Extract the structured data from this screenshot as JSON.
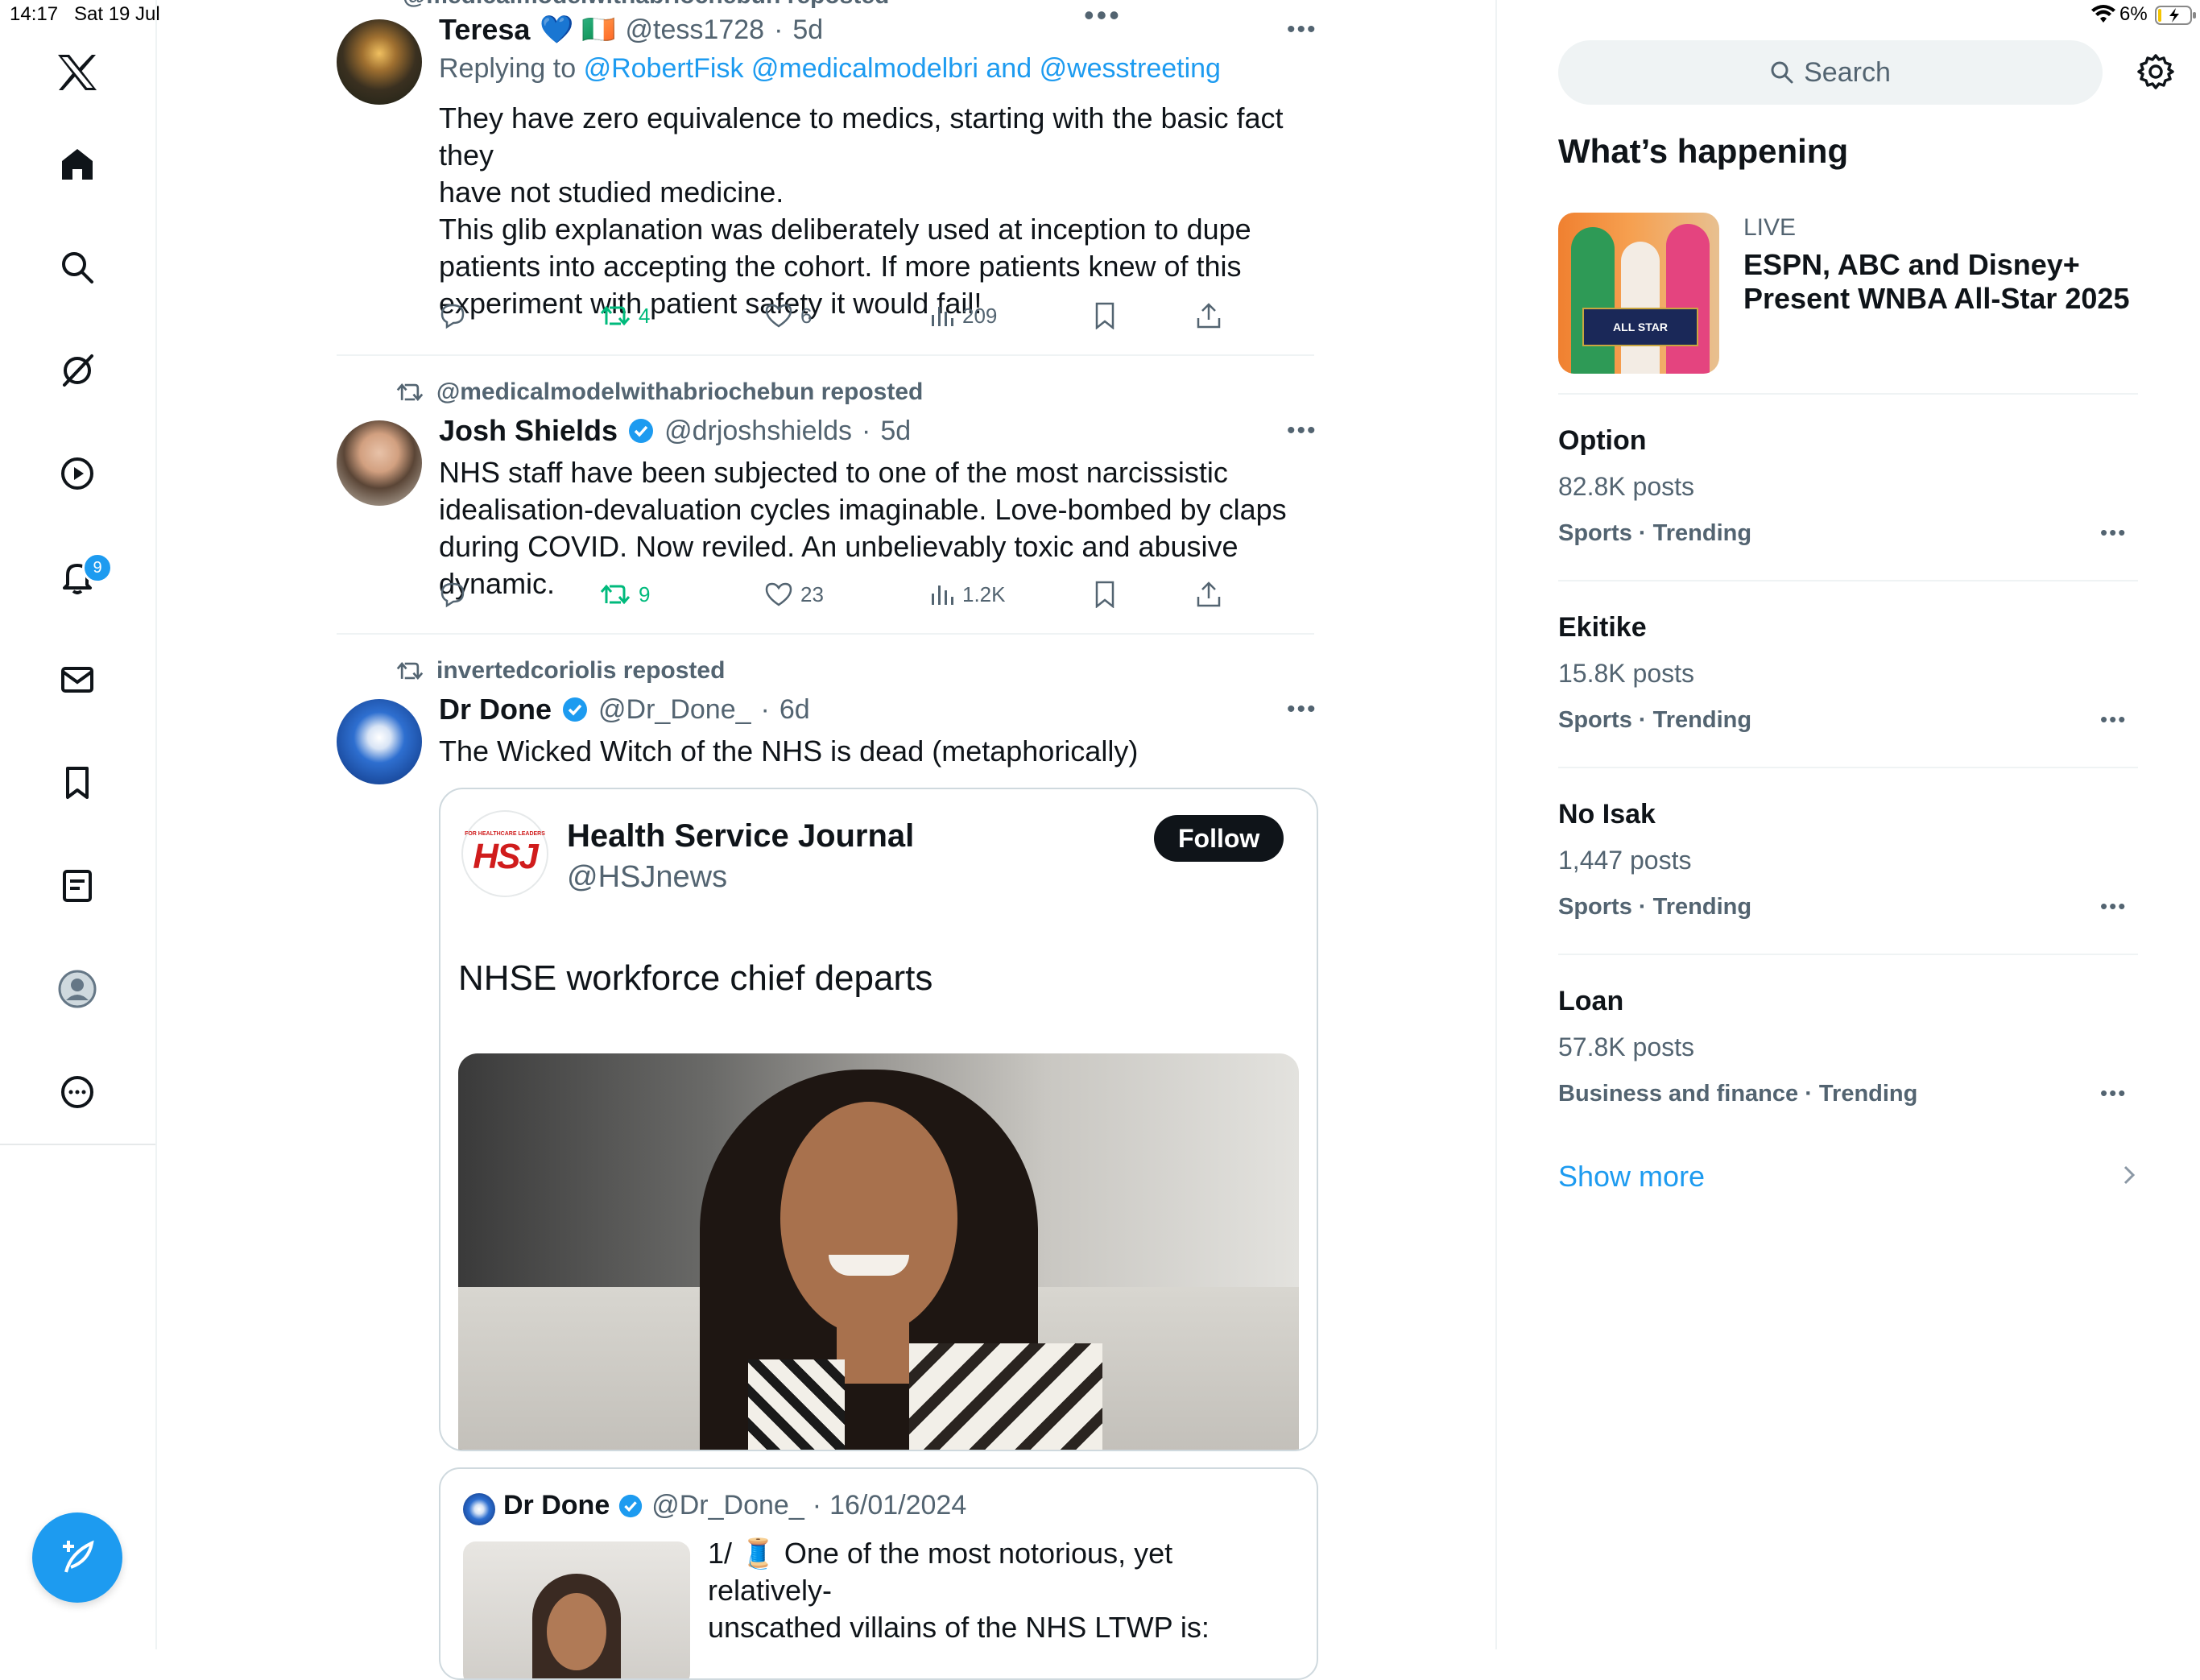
{
  "status_bar": {
    "time": "14:17",
    "date": "Sat 19 Jul",
    "battery": "6%"
  },
  "nav": {
    "notification_count": "9"
  },
  "feed": {
    "top_cut_text": "@medicalmodelwithabriochebun reposted",
    "tweets": [
      {
        "name": "Teresa",
        "name_emojis": "💙 🇮🇪",
        "handle": "@tess1728",
        "time": "5d",
        "replying_prefix": "Replying to",
        "replying_targets": "@RobertFisk @medicalmodelbri and @wesstreeting",
        "lines": [
          "They have zero equivalence to medics, starting with the basic fact they",
          "have not studied medicine.",
          "This glib explanation was  deliberately used at inception  to dupe",
          "patients into accepting the cohort. If more patients knew of this",
          "experiment with patient safety it would fail!"
        ],
        "retweets": "4",
        "likes": "6",
        "views": "209"
      },
      {
        "reposted_by": "@medicalmodelwithabriochebun reposted",
        "name": "Josh Shields",
        "handle": "@drjoshshields",
        "time": "5d",
        "lines": [
          "NHS staff have been subjected to one of the most narcissistic",
          "idealisation-devaluation cycles imaginable. Love-bombed by claps",
          "during COVID. Now reviled. An unbelievably toxic and abusive dynamic."
        ],
        "retweets": "9",
        "likes": "23",
        "views": "1.2K"
      },
      {
        "reposted_by": "invertedcoriolis reposted",
        "name": "Dr Done",
        "handle": "@Dr_Done_",
        "time": "6d",
        "text": "The Wicked Witch of the NHS is dead (metaphorically)",
        "card": {
          "logo_small": "FOR HEALTHCARE LEADERS",
          "logo": "HSJ",
          "account_name": "Health Service Journal",
          "account_handle": "@HSJnews",
          "follow_label": "Follow",
          "headline": "NHSE workforce chief departs"
        },
        "quote": {
          "name": "Dr Done",
          "handle": "@Dr_Done_",
          "date": "16/01/2024",
          "line1": "1/ 🧵 One of the most notorious, yet relatively-",
          "line2": "unscathed villains of the NHS LTWP is:"
        }
      }
    ]
  },
  "sidebar": {
    "search_placeholder": "Search",
    "section_title": "What’s happening",
    "live": {
      "label": "LIVE",
      "title_line1": "ESPN, ABC and Disney+",
      "title_line2": "Present WNBA All-Star 2025",
      "thumb_text": "ALL STAR"
    },
    "trends": [
      {
        "title": "Option",
        "count": "82.8K posts",
        "meta": "Sports · Trending"
      },
      {
        "title": "Ekitike",
        "count": "15.8K posts",
        "meta": "Sports · Trending"
      },
      {
        "title": "No Isak",
        "count": "1,447 posts",
        "meta": "Sports · Trending"
      },
      {
        "title": "Loan",
        "count": "57.8K posts",
        "meta": "Business and finance · Trending"
      }
    ],
    "show_more": "Show more"
  }
}
